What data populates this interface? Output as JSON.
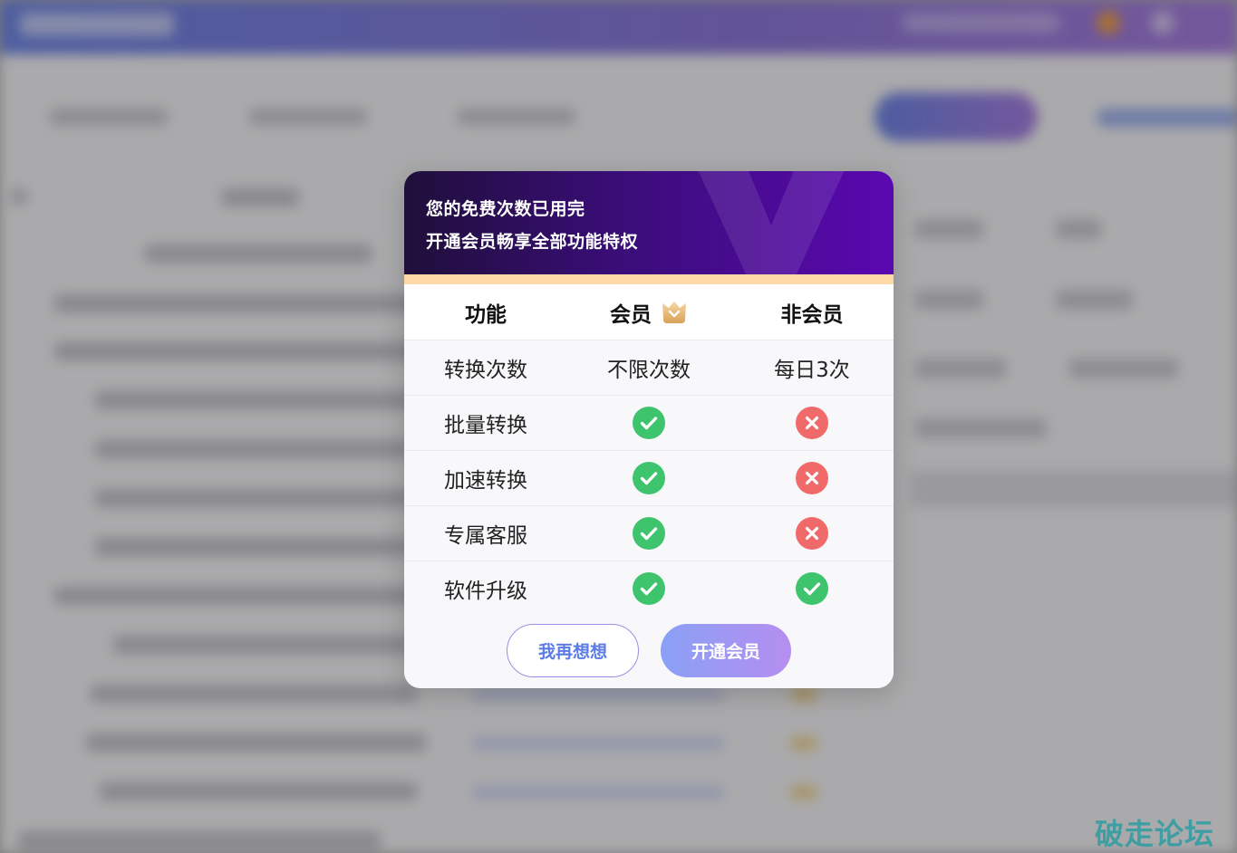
{
  "dialog": {
    "title_line1": "您的免费次数已用完",
    "title_line2": "开通会员畅享全部功能特权",
    "table": {
      "headers": [
        "功能",
        "会员",
        "非会员"
      ],
      "rows": [
        {
          "feature": "转换次数",
          "member": "不限次数",
          "nonmember": "每日3次"
        },
        {
          "feature": "批量转换",
          "member": "check",
          "nonmember": "cross"
        },
        {
          "feature": "加速转换",
          "member": "check",
          "nonmember": "cross"
        },
        {
          "feature": "专属客服",
          "member": "check",
          "nonmember": "cross"
        },
        {
          "feature": "软件升级",
          "member": "check",
          "nonmember": "check"
        }
      ]
    },
    "cancel_label": "我再想想",
    "confirm_label": "开通会员"
  },
  "colors": {
    "check": "#3ec46d",
    "cross": "#f06a6a",
    "accent": "#5b7be6"
  },
  "watermark": "破走论坛"
}
